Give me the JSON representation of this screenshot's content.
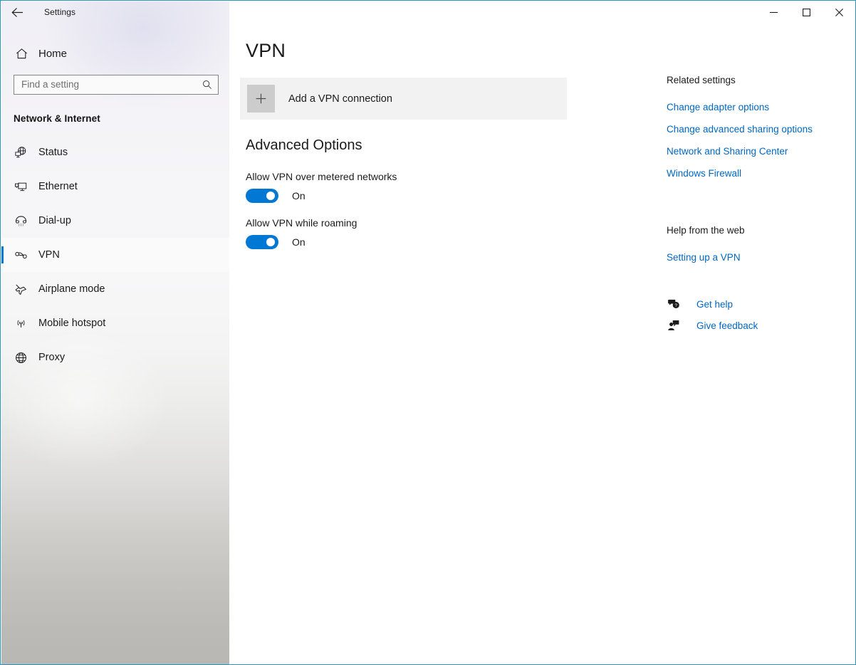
{
  "window": {
    "app_title": "Settings",
    "back_icon": "back-arrow-icon",
    "minimize_label": "Minimize",
    "maximize_label": "Maximize",
    "close_label": "Close",
    "border_color": "#2d95bf"
  },
  "sidebar": {
    "home": {
      "label": "Home",
      "icon": "home-icon"
    },
    "search": {
      "placeholder": "Find a setting",
      "value": "",
      "icon": "search-icon"
    },
    "category_title": "Network & Internet",
    "accent_color": "#0078d4",
    "items": [
      {
        "label": "Status",
        "icon": "globe-monitor-icon",
        "selected": false
      },
      {
        "label": "Ethernet",
        "icon": "ethernet-monitor-icon",
        "selected": false
      },
      {
        "label": "Dial-up",
        "icon": "telephone-icon",
        "selected": false
      },
      {
        "label": "VPN",
        "icon": "vpn-key-icon",
        "selected": true
      },
      {
        "label": "Airplane mode",
        "icon": "airplane-icon",
        "selected": false
      },
      {
        "label": "Mobile hotspot",
        "icon": "hotspot-broadcast-icon",
        "selected": false
      },
      {
        "label": "Proxy",
        "icon": "globe-icon",
        "selected": false
      }
    ]
  },
  "main": {
    "page_title": "VPN",
    "add_connection": {
      "label": "Add a VPN connection",
      "icon": "plus-icon"
    },
    "advanced_heading": "Advanced Options",
    "settings": [
      {
        "label": "Allow VPN over metered networks",
        "state": "On",
        "checked": true
      },
      {
        "label": "Allow VPN while roaming",
        "state": "On",
        "checked": true
      }
    ]
  },
  "right_rail": {
    "related_heading": "Related settings",
    "related_links": [
      "Change adapter options",
      "Change advanced sharing options",
      "Network and Sharing Center",
      "Windows Firewall"
    ],
    "help_heading": "Help from the web",
    "help_links": [
      "Setting up a VPN"
    ],
    "support": [
      {
        "label": "Get help",
        "icon": "question-bubble-icon"
      },
      {
        "label": "Give feedback",
        "icon": "feedback-person-icon"
      }
    ],
    "link_color": "#0067c0"
  }
}
